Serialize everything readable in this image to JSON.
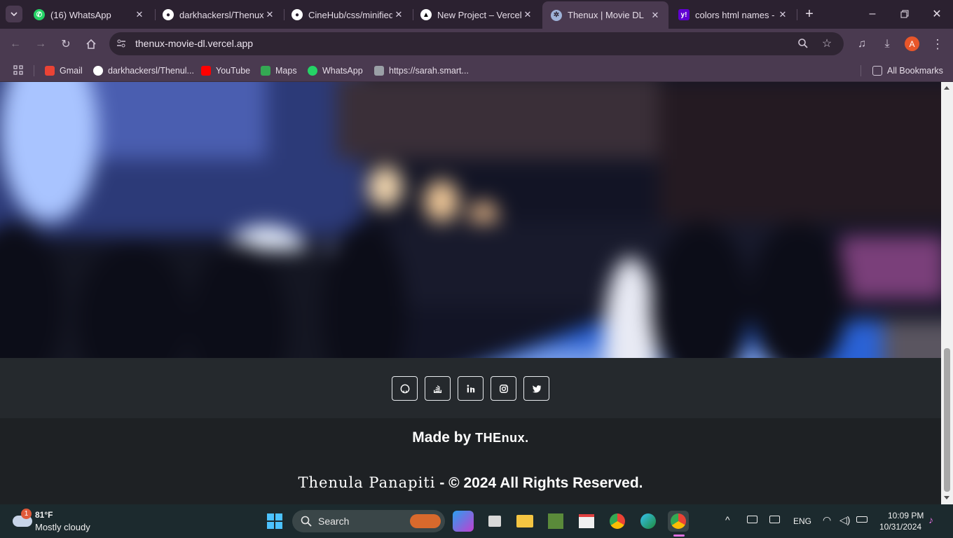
{
  "browser": {
    "tabs": [
      {
        "title": "(16) WhatsApp",
        "icon": "whatsapp-icon",
        "color": "#25d366"
      },
      {
        "title": "darkhackersl/Thenux",
        "icon": "github-icon",
        "color": "#ffffff"
      },
      {
        "title": "CineHub/css/minified",
        "icon": "github-icon",
        "color": "#ffffff"
      },
      {
        "title": "New Project – Vercel",
        "icon": "vercel-icon",
        "color": "#ffffff"
      },
      {
        "title": "Thenux | Movie DL",
        "icon": "site-icon",
        "color": "#9fb3d9"
      },
      {
        "title": "colors html names - Y",
        "icon": "yahoo-icon",
        "color": "#6001d2"
      }
    ],
    "url": "thenux-movie-dl.vercel.app",
    "bookmarks": [
      {
        "label": "Gmail",
        "color": "#ea4335"
      },
      {
        "label": "darkhackersl/Thenul...",
        "color": "#ffffff"
      },
      {
        "label": "YouTube",
        "color": "#ff0000"
      },
      {
        "label": "Maps",
        "color": "#34a853"
      },
      {
        "label": "WhatsApp",
        "color": "#25d366"
      },
      {
        "label": "https://sarah.smart...",
        "color": "#9aa0a6"
      }
    ],
    "all_bookmarks": "All Bookmarks",
    "profile_initial": "A"
  },
  "page": {
    "social_links": [
      "github-icon",
      "stackexchange-icon",
      "linkedin-icon",
      "instagram-icon",
      "twitter-icon"
    ],
    "made_by_prefix": "Made by",
    "made_by_brand": "THEnux.",
    "copyright_name": "Thenula Panapiti",
    "copyright_rest": "- © 2024 All Rights Reserved."
  },
  "taskbar": {
    "weather_temp": "81°F",
    "weather_desc": "Mostly cloudy",
    "weather_badge": "1",
    "search_label": "Search",
    "language": "ENG",
    "time": "10:09 PM",
    "date": "10/31/2024"
  }
}
